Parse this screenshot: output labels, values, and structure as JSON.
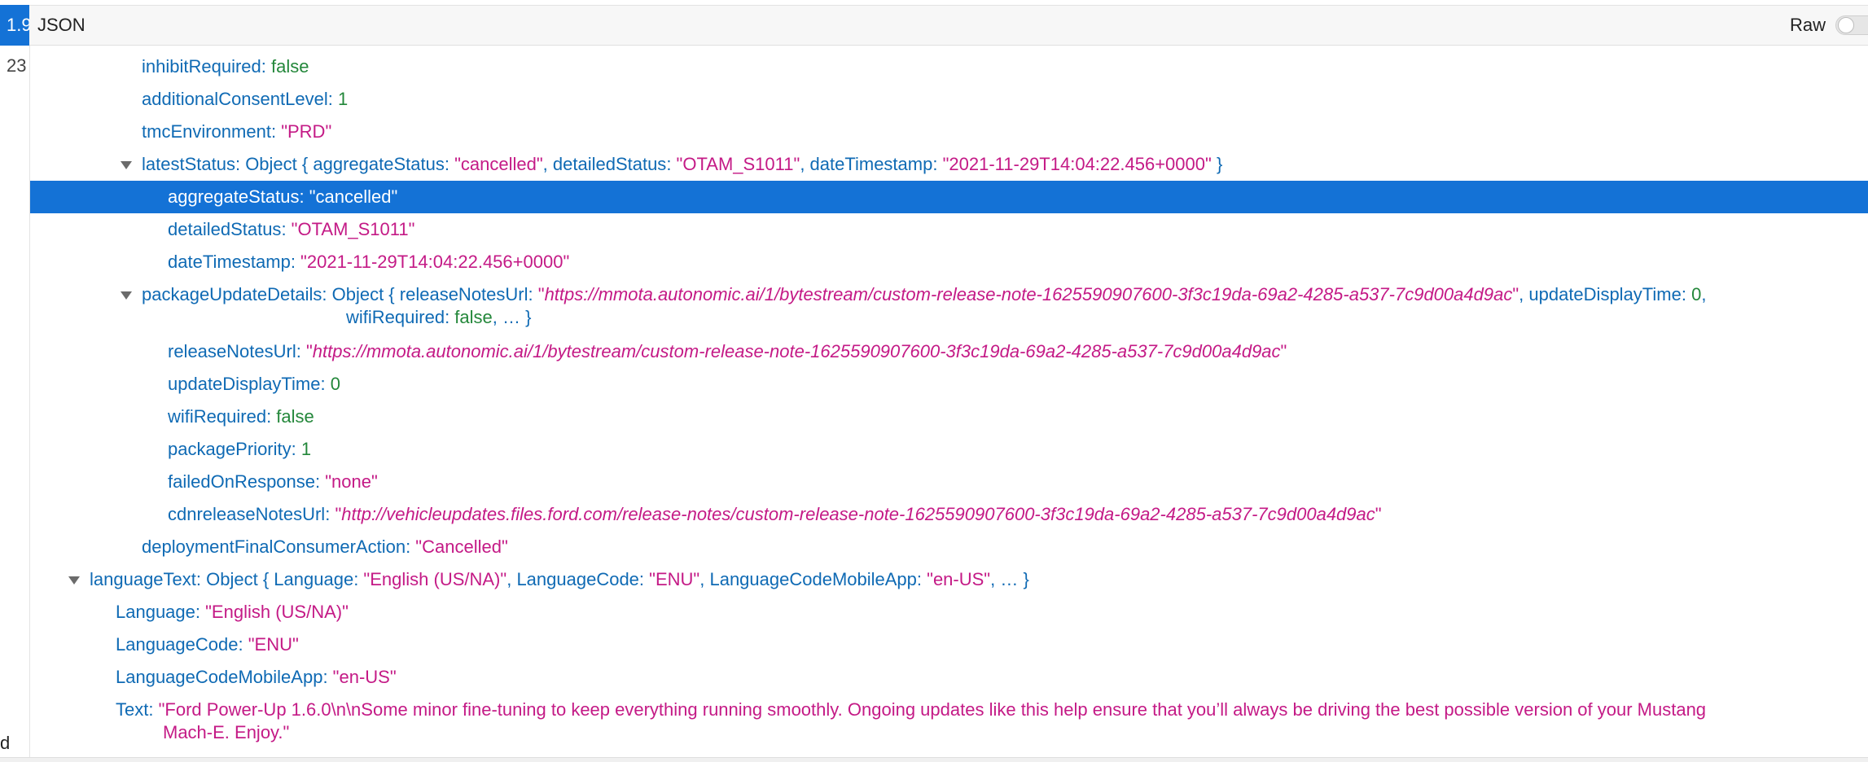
{
  "gutter": {
    "active_label": "1.9",
    "line_number": "23",
    "bottom_label": "d"
  },
  "header": {
    "title": "JSON",
    "raw_label": "Raw"
  },
  "tree": {
    "inhibitRequired": {
      "key": "inhibitRequired",
      "value": "false"
    },
    "additionalConsentLevel": {
      "key": "additionalConsentLevel",
      "value": "1"
    },
    "tmcEnvironment": {
      "key": "tmcEnvironment",
      "value": "\"PRD\""
    },
    "latestStatus": {
      "key": "latestStatus",
      "summary_prefix": "Object {",
      "s1_key": "aggregateStatus",
      "s1_val": "\"cancelled\"",
      "s2_key": "detailedStatus",
      "s2_val": "\"OTAM_S1011\"",
      "s3_key": "dateTimestamp",
      "s3_val": "\"2021-11-29T14:04:22.456+0000\"",
      "summary_suffix": "}",
      "children": {
        "aggregateStatus": {
          "key": "aggregateStatus",
          "value": "\"cancelled\""
        },
        "detailedStatus": {
          "key": "detailedStatus",
          "value": "\"OTAM_S1011\""
        },
        "dateTimestamp": {
          "key": "dateTimestamp",
          "value": "\"2021-11-29T14:04:22.456+0000\""
        }
      }
    },
    "packageUpdateDetails": {
      "key": "packageUpdateDetails",
      "summary_prefix": "Object {",
      "s1_key": "releaseNotesUrl",
      "s1_quote_open": "\"",
      "s1_url": "https://mmota.autonomic.ai/1/bytestream/custom-release-note-1625590907600-3f3c19da-69a2-4285-a537-7c9d00a4d9ac",
      "s1_quote_close": "\"",
      "s2_key": "updateDisplayTime",
      "s2_val": "0",
      "s3_key": "wifiRequired",
      "s3_val": "false",
      "summary_suffix": "… }",
      "children": {
        "releaseNotesUrl": {
          "key": "releaseNotesUrl",
          "quote_open": "\"",
          "url": "https://mmota.autonomic.ai/1/bytestream/custom-release-note-1625590907600-3f3c19da-69a2-4285-a537-7c9d00a4d9ac",
          "quote_close": "\""
        },
        "updateDisplayTime": {
          "key": "updateDisplayTime",
          "value": "0"
        },
        "wifiRequired": {
          "key": "wifiRequired",
          "value": "false"
        },
        "packagePriority": {
          "key": "packagePriority",
          "value": "1"
        },
        "failedOnResponse": {
          "key": "failedOnResponse",
          "value": "\"none\""
        },
        "cdnreleaseNotesUrl": {
          "key": "cdnreleaseNotesUrl",
          "quote_open": "\"",
          "url": "http://vehicleupdates.files.ford.com/release-notes/custom-release-note-1625590907600-3f3c19da-69a2-4285-a537-7c9d00a4d9ac",
          "quote_close": "\""
        }
      }
    },
    "deploymentFinalConsumerAction": {
      "key": "deploymentFinalConsumerAction",
      "value": "\"Cancelled\""
    },
    "languageText": {
      "key": "languageText",
      "summary_prefix": "Object {",
      "s1_key": "Language",
      "s1_val": "\"English (US/NA)\"",
      "s2_key": "LanguageCode",
      "s2_val": "\"ENU\"",
      "s3_key": "LanguageCodeMobileApp",
      "s3_val": "\"en-US\"",
      "summary_suffix": "… }",
      "children": {
        "Language": {
          "key": "Language",
          "value": "\"English (US/NA)\""
        },
        "LanguageCode": {
          "key": "LanguageCode",
          "value": "\"ENU\""
        },
        "LanguageCodeMobileApp": {
          "key": "LanguageCodeMobileApp",
          "value": "\"en-US\""
        },
        "Text": {
          "key": "Text",
          "value_line1": "\"Ford Power-Up 1.6.0\\n\\nSome minor fine-tuning to keep everything running smoothly. Ongoing updates like this help ensure that you’ll always be driving the best possible version of your Mustang",
          "value_line2": "Mach-E. Enjoy.\""
        }
      }
    }
  },
  "colors": {
    "key": "#0f6ab4",
    "string": "#c41a86",
    "number": "#23873a",
    "selection": "#1472d6"
  }
}
